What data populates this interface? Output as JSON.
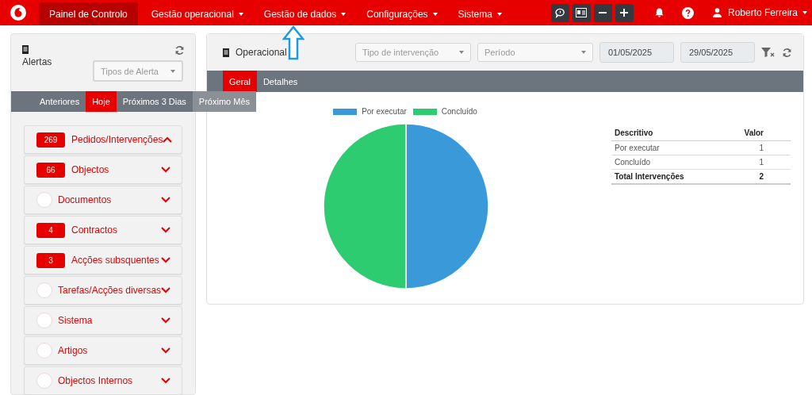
{
  "nav": {
    "items": [
      {
        "label": "Painel de Controlo",
        "selected": true,
        "dropdown": false
      },
      {
        "label": "Gestão operacional",
        "selected": false,
        "dropdown": true
      },
      {
        "label": "Gestão de dados",
        "selected": false,
        "dropdown": true
      },
      {
        "label": "Configurações",
        "selected": false,
        "dropdown": true
      },
      {
        "label": "Sistema",
        "selected": false,
        "dropdown": true
      }
    ],
    "user": "Roberto Ferreira"
  },
  "alerts": {
    "title": "Alertas",
    "filter": {
      "placeholder": "Tipos de Alerta"
    },
    "tabs": [
      {
        "label": "Anteriores",
        "selected": false,
        "hovered": false
      },
      {
        "label": "Hoje",
        "selected": true,
        "hovered": false
      },
      {
        "label": "Próximos 3 Dias",
        "selected": false,
        "hovered": false
      },
      {
        "label": "Próximo Mês",
        "selected": false,
        "hovered": true
      }
    ],
    "items": [
      {
        "label": "Pedidos/Intervenções",
        "count": "269",
        "expanded": true
      },
      {
        "label": "Objectos",
        "count": "66",
        "expanded": false
      },
      {
        "label": "Documentos",
        "expanded": false
      },
      {
        "label": "Contractos",
        "count": "4",
        "expanded": false
      },
      {
        "label": "Acções subsquentes",
        "count": "3",
        "expanded": false
      },
      {
        "label": "Tarefas/Acções diversas",
        "expanded": false
      },
      {
        "label": "Sistema",
        "expanded": false
      },
      {
        "label": "Artigos",
        "expanded": false
      },
      {
        "label": "Objectos Internos",
        "expanded": false
      }
    ]
  },
  "operational": {
    "title": "Operacional",
    "filters": [
      {
        "placeholder": "Tipo de intervenção"
      },
      {
        "placeholder": "Período"
      }
    ],
    "dates": [
      "01/05/2025",
      "29/05/2025"
    ],
    "tabs": [
      {
        "label": "Geral",
        "selected": true
      },
      {
        "label": "Detalhes",
        "selected": false
      }
    ],
    "chart_data": {
      "type": "pie",
      "categories": [
        "Por executar",
        "Concluído"
      ],
      "values": [
        50,
        50
      ],
      "colors": [
        "#3a99d8",
        "#2ecc71"
      ],
      "legend": "top"
    },
    "table": {
      "columns": [
        "Descritivo",
        "Valor"
      ],
      "rows": [
        {
          "cells": [
            "Por executar",
            "1"
          ],
          "total": false
        },
        {
          "cells": [
            "Concluído",
            "1"
          ],
          "total": false
        },
        {
          "cells": [
            "Total Intervenções",
            "2"
          ],
          "total": true
        }
      ]
    }
  }
}
